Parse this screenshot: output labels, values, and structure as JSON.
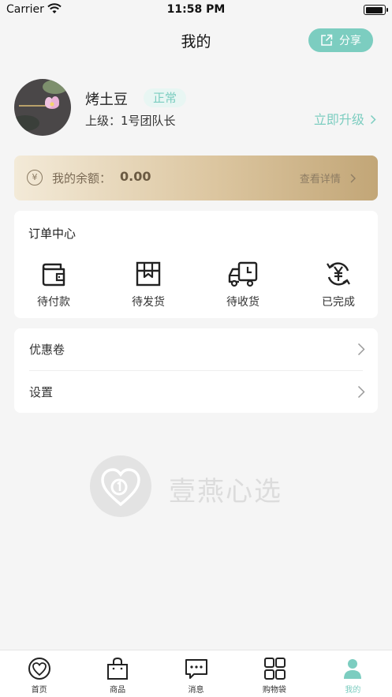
{
  "status_bar": {
    "carrier": "Carrier",
    "time": "11:58 PM"
  },
  "nav": {
    "title": "我的",
    "share_label": "分享"
  },
  "profile": {
    "name": "烤土豆",
    "status": "正常",
    "superior": "上级：1号团队长",
    "upgrade_label": "立即升级"
  },
  "balance": {
    "label": "我的余额：",
    "value": "0.00",
    "detail_label": "查看详情",
    "currency_symbol": "¥"
  },
  "orders": {
    "title": "订单中心",
    "items": [
      {
        "label": "待付款",
        "icon": "wallet-icon"
      },
      {
        "label": "待发货",
        "icon": "box-icon"
      },
      {
        "label": "待收货",
        "icon": "truck-icon"
      },
      {
        "label": "已完成",
        "icon": "yuan-cycle-icon"
      }
    ]
  },
  "menu": {
    "items": [
      {
        "label": "优惠卷"
      },
      {
        "label": "设置"
      }
    ]
  },
  "watermark": {
    "text": "壹燕心选"
  },
  "tabbar": {
    "items": [
      {
        "label": "首页",
        "icon": "heart-logo-icon"
      },
      {
        "label": "商品",
        "icon": "shopping-bag-icon"
      },
      {
        "label": "消息",
        "icon": "message-icon"
      },
      {
        "label": "购物袋",
        "icon": "grid-icon"
      },
      {
        "label": "我的",
        "icon": "person-icon"
      }
    ],
    "active_index": 4
  },
  "colors": {
    "accent": "#7ccdc0",
    "balance_gradient_start": "#f3ead8",
    "balance_gradient_end": "#c2a677"
  }
}
